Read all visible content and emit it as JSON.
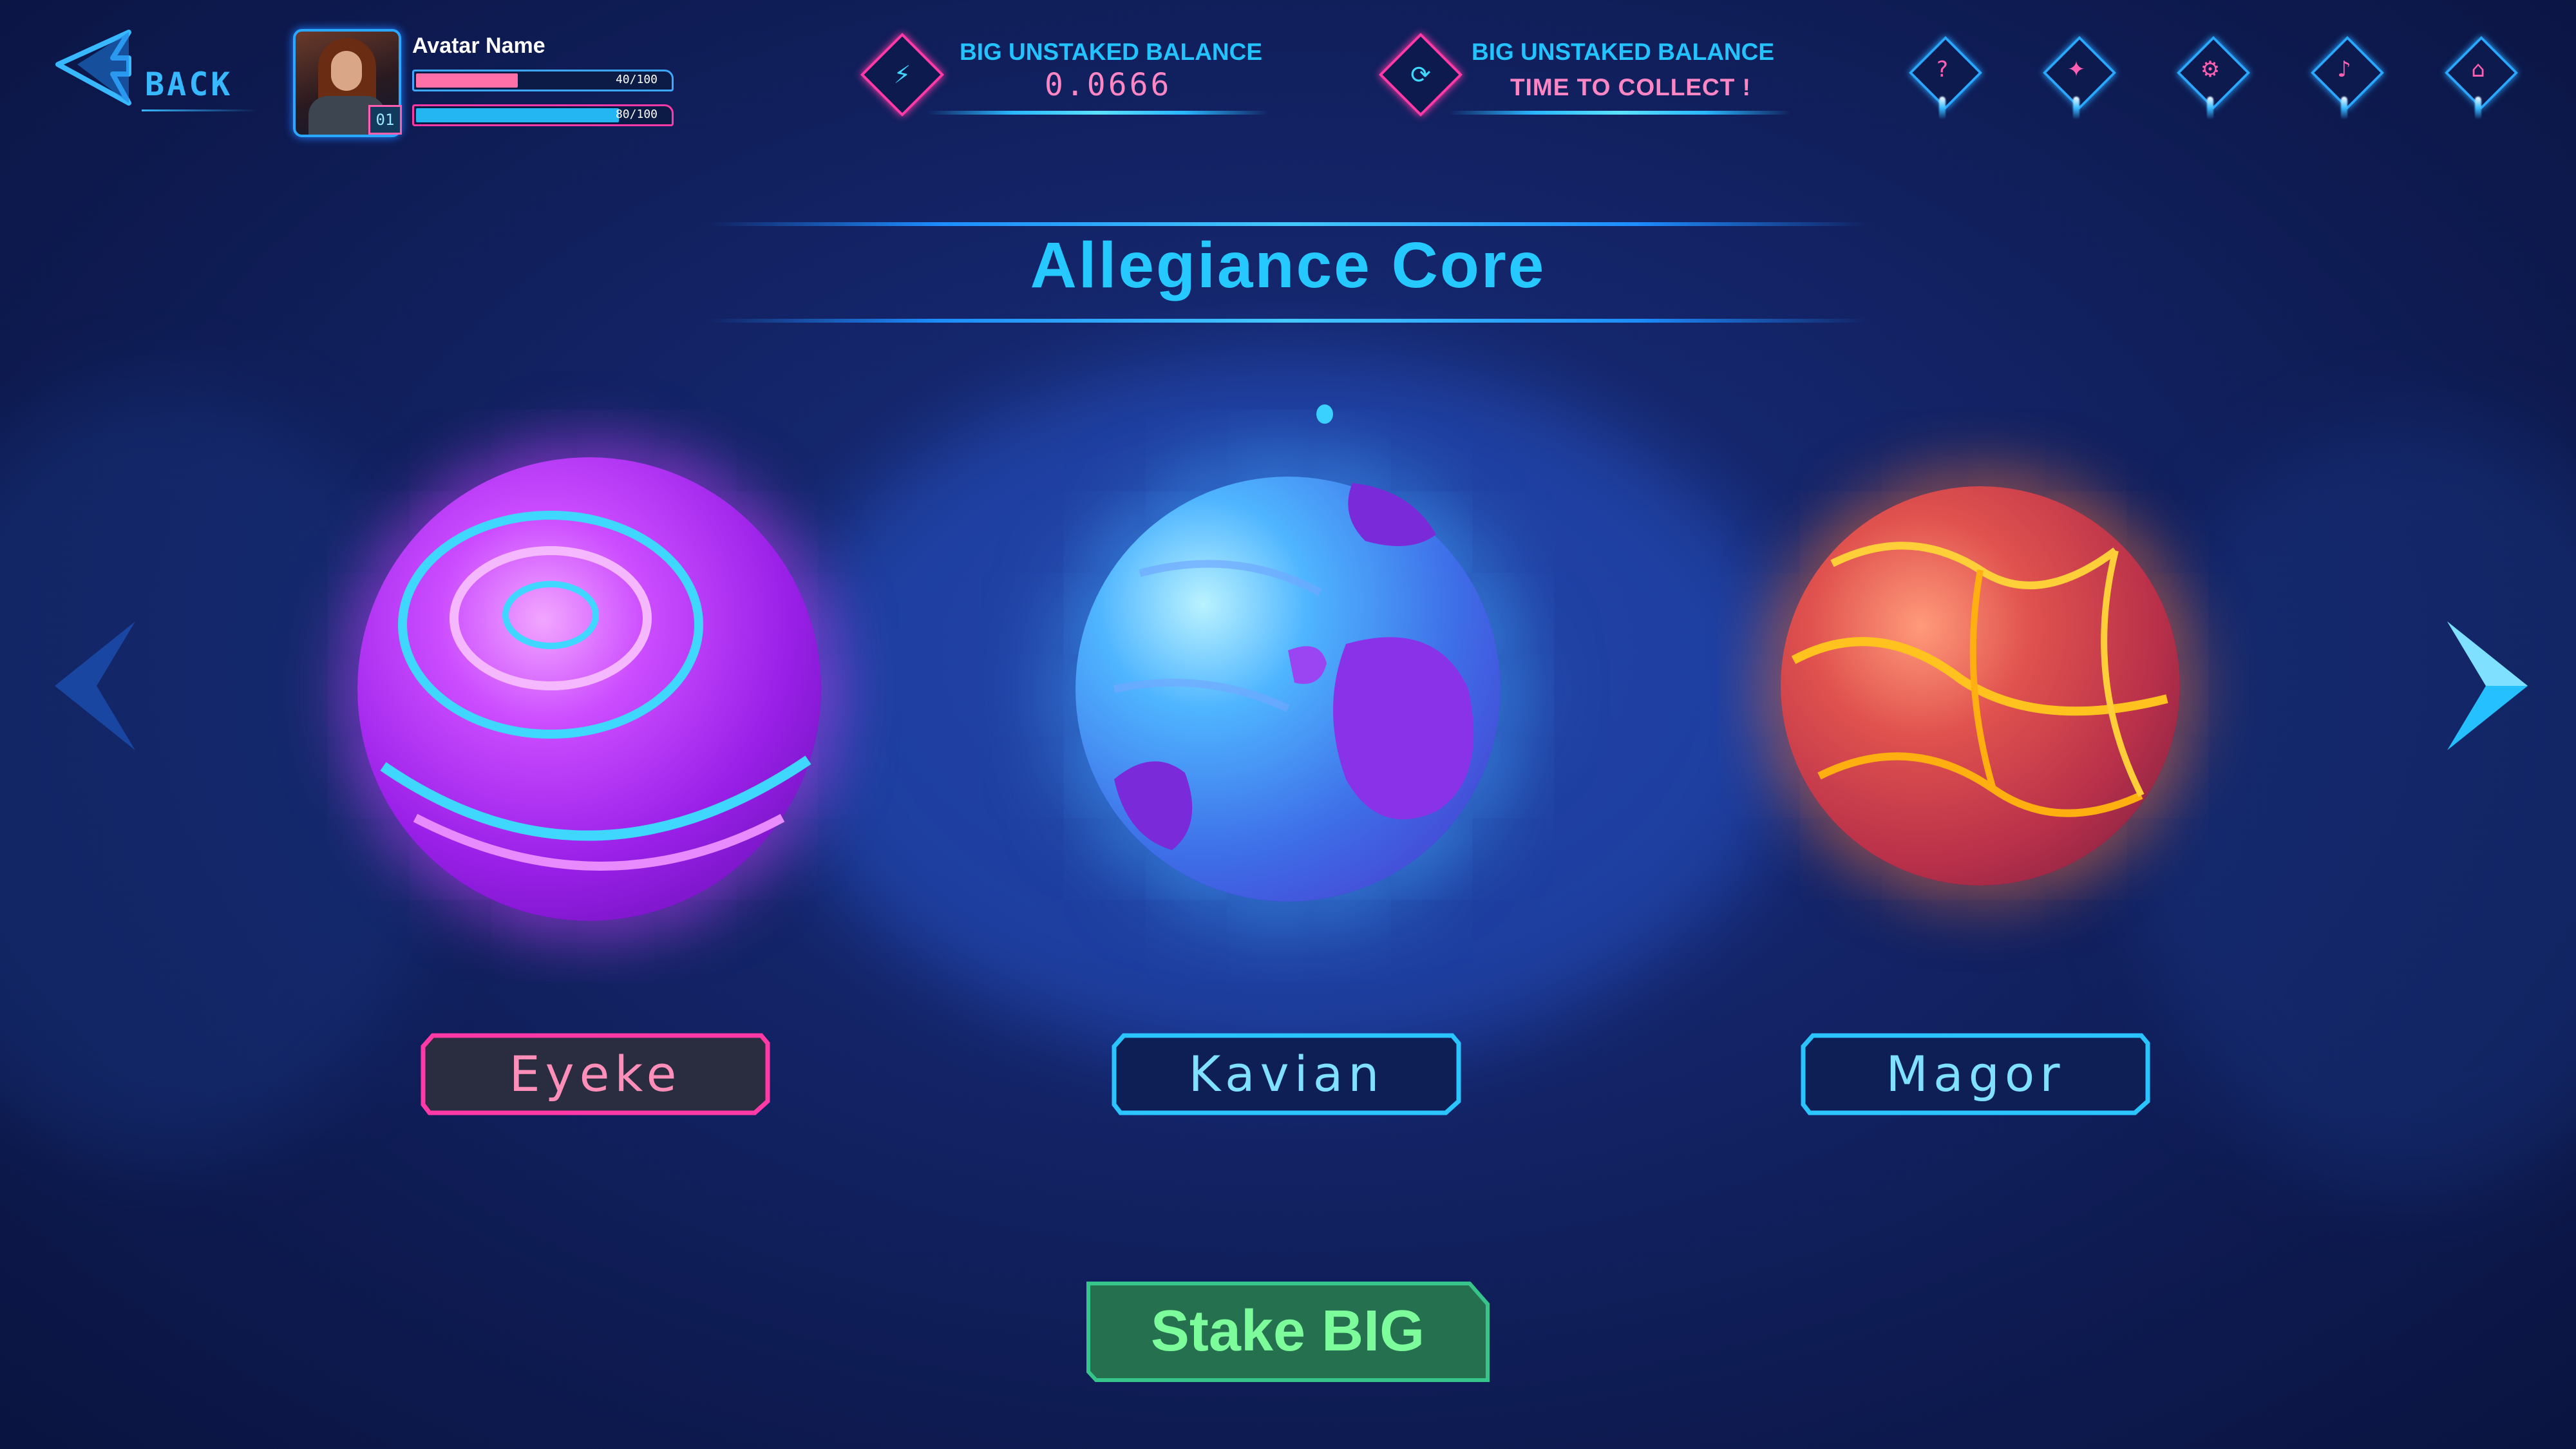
{
  "header": {
    "back_label": "BACK",
    "avatar_name": "Avatar Name",
    "level": "01",
    "bar1": {
      "text": "40/100",
      "value": 0.4,
      "color": "#ff6fa8"
    },
    "bar2": {
      "text": "80/100",
      "value": 0.8,
      "color": "#23b6f2"
    },
    "balance1": {
      "label": "BIG UNSTAKED BALANCE",
      "value": "0.0666",
      "icon": "lightning-icon"
    },
    "balance2": {
      "label": "BIG UNSTAKED BALANCE",
      "value": "TIME TO COLLECT !",
      "icon": "refresh-icon"
    },
    "icons": [
      "help-icon",
      "game-icon",
      "gear-icon",
      "bell-icon",
      "home-icon"
    ]
  },
  "title": "Allegiance Core",
  "planets": [
    {
      "name": "Eyeke",
      "selected": true,
      "color": "#b23bff"
    },
    {
      "name": "Kavian",
      "selected": false,
      "color": "#4a8cff"
    },
    {
      "name": "Magor",
      "selected": false,
      "color": "#c44a4a"
    }
  ],
  "action": {
    "label": "Stake BIG"
  },
  "colors": {
    "accent": "#25c8ff",
    "pink": "#ff3aa6",
    "green": "#2f9e63"
  }
}
